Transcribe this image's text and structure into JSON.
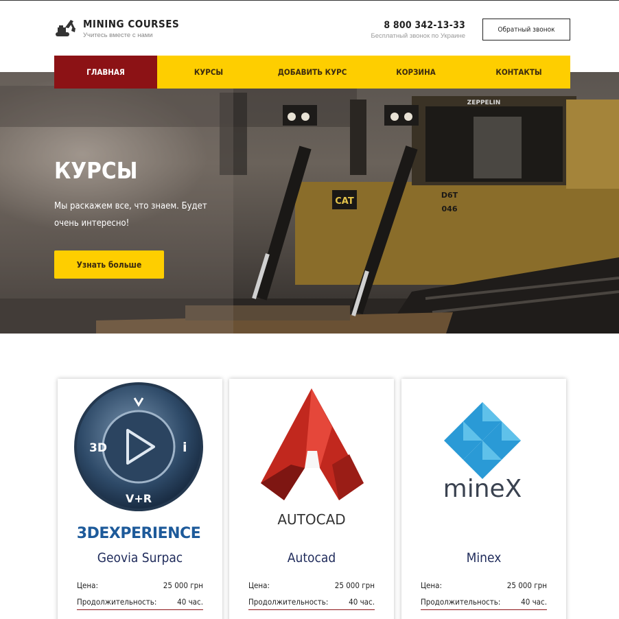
{
  "header": {
    "brand_title": "MINING COURSES",
    "brand_subtitle": "Учитесь вместе с нами",
    "phone_number": "8 800 342-13-33",
    "phone_note": "Бесплатный звонок по Украине",
    "callback_label": "Обратный звонок"
  },
  "nav": {
    "items": [
      {
        "label": "Главная",
        "active": true
      },
      {
        "label": "Курсы",
        "active": false
      },
      {
        "label": "Добавить курс",
        "active": false
      },
      {
        "label": "Корзина",
        "active": false
      },
      {
        "label": "Контакты",
        "active": false
      }
    ]
  },
  "hero": {
    "title": "КУРСЫ",
    "text": "Мы раскажем все, что знаем. Будет очень интересно!",
    "button_label": "Узнать больше",
    "machine_label": "CAT",
    "machine_model": "D6T",
    "machine_number": "046",
    "brand_plate": "ZEPPELIN"
  },
  "courses": [
    {
      "name": "Geovia Surpac",
      "logo_text": "3DEXPERIENCE",
      "badge_3d": "3D",
      "badge_vr": "V+R",
      "badge_ii": "i",
      "price_label": "Цена:",
      "price_value": "25 000 грн",
      "duration_label": "Продолжительность:",
      "duration_value": "40 час."
    },
    {
      "name": "Autocad",
      "logo_text": "AUTOCAD",
      "price_label": "Цена:",
      "price_value": "25 000 грн",
      "duration_label": "Продолжительность:",
      "duration_value": "40 час."
    },
    {
      "name": "Minex",
      "logo_text": "mineX",
      "price_label": "Цена:",
      "price_value": "25 000 грн",
      "duration_label": "Продолжительность:",
      "duration_value": "40 час."
    }
  ],
  "colors": {
    "accent_yellow": "#fece00",
    "accent_red": "#8c1215",
    "title_navy": "#1e2a5a"
  }
}
